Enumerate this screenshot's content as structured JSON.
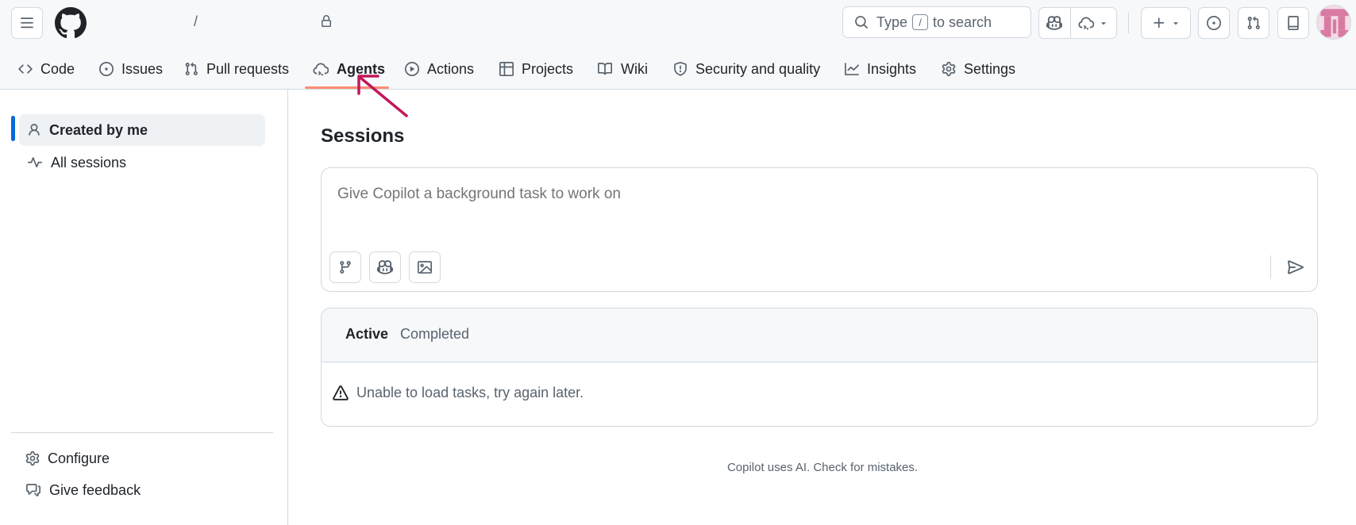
{
  "header": {
    "breadcrumb_separator": "/",
    "search": {
      "prefix": "Type",
      "key": "/",
      "suffix": "to search"
    }
  },
  "repo_nav": {
    "tabs": [
      {
        "label": "Code",
        "icon": "code-icon"
      },
      {
        "label": "Issues",
        "icon": "issue-opened-icon"
      },
      {
        "label": "Pull requests",
        "icon": "git-pull-request-icon"
      },
      {
        "label": "Agents",
        "icon": "agent-cloud-icon",
        "selected": true
      },
      {
        "label": "Actions",
        "icon": "play-icon"
      },
      {
        "label": "Projects",
        "icon": "table-icon"
      },
      {
        "label": "Wiki",
        "icon": "book-icon"
      },
      {
        "label": "Security and quality",
        "icon": "shield-icon"
      },
      {
        "label": "Insights",
        "icon": "graph-icon"
      },
      {
        "label": "Settings",
        "icon": "gear-icon"
      }
    ]
  },
  "sidebar": {
    "items": [
      {
        "label": "Created by me",
        "icon": "person-icon",
        "active": true
      },
      {
        "label": "All sessions",
        "icon": "pulse-icon"
      }
    ],
    "footer": [
      {
        "label": "Configure",
        "icon": "gear-icon"
      },
      {
        "label": "Give feedback",
        "icon": "comment-icon"
      }
    ]
  },
  "main": {
    "title": "Sessions",
    "composer": {
      "placeholder": "Give Copilot a background task to work on"
    },
    "tasks": {
      "tabs": [
        {
          "label": "Active",
          "active": true
        },
        {
          "label": "Completed"
        }
      ],
      "error": "Unable to load tasks, try again later."
    },
    "disclaimer": {
      "link": "Copilot",
      "text": " uses AI. Check for mistakes."
    }
  },
  "colors": {
    "accent": "#0969da",
    "tab_underline": "#fd8c73",
    "annotation": "#c2185b"
  }
}
